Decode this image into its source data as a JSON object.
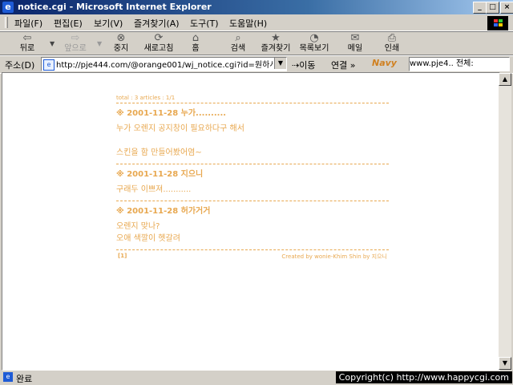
{
  "window": {
    "title": "notice.cgi - Microsoft Internet Explorer",
    "minimize": "_",
    "maximize": "□",
    "close": "×"
  },
  "menu": [
    "파일(F)",
    "편집(E)",
    "보기(V)",
    "즐겨찾기(A)",
    "도구(T)",
    "도움말(H)"
  ],
  "toolbar": {
    "back": "뒤로",
    "forward": "앞으로",
    "stop": "중지",
    "refresh": "새로고침",
    "home": "홈",
    "search": "검색",
    "favorites": "즐겨찾기",
    "history": "목록보기",
    "mail": "메일",
    "print": "인쇄"
  },
  "address": {
    "label": "주소(D)",
    "url": "http://pje444.com/@orange001/wj_notice.cgi?id=원하시",
    "go": "이동",
    "links": "연결 »",
    "navy_logo": "Navy",
    "navy_text": "www.pje4..    전체:"
  },
  "board": {
    "total": "total : 3 articles : 1/1",
    "entries": [
      {
        "title": "※ 2001-11-28 누가..........",
        "body": [
          "누가 오렌지 공지창이 필요하다구 해서",
          "",
          "스킨을 함 만들어봤어염~"
        ]
      },
      {
        "title": "※ 2001-11-28 지으니",
        "body": [
          "구래두 이쁘져..........."
        ]
      },
      {
        "title": "※ 2001-11-28 허가거거",
        "body": [
          "오렌지 맞나?",
          "오애 색깔이 헷갈려"
        ]
      }
    ],
    "page": "[1]",
    "credit": "Created by wonie-Khim Shin by 지으니"
  },
  "status": {
    "text": "완료",
    "copyright": "Copyright(c) http://www.happycgi.com"
  }
}
